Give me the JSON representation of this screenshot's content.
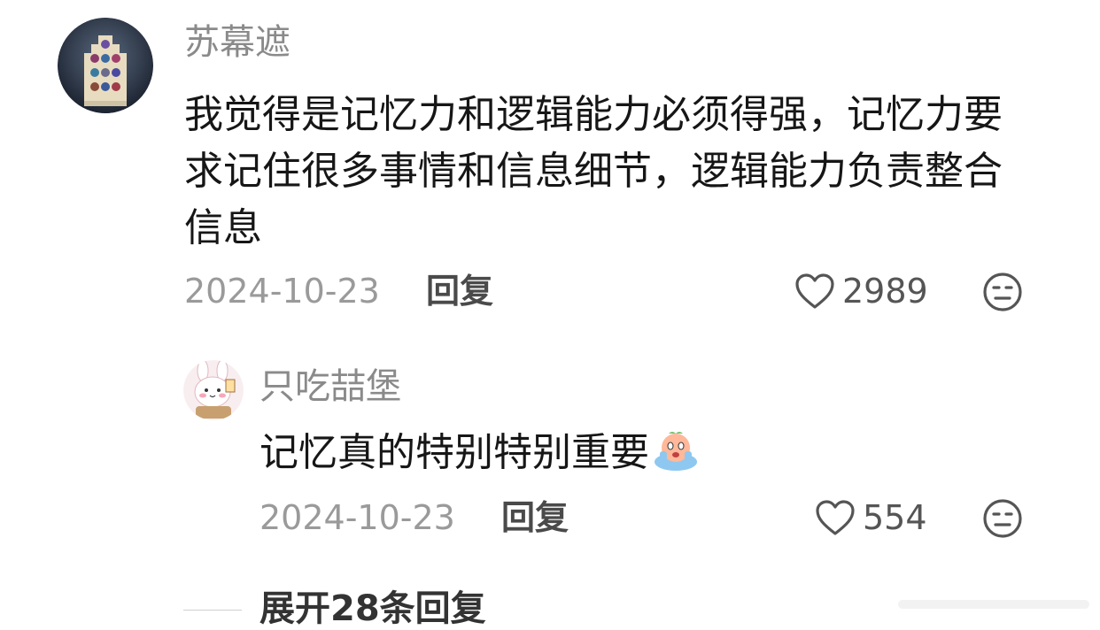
{
  "comments": [
    {
      "username": "苏幕遮",
      "text": "我觉得是记忆力和逻辑能力必须得强，记忆力要求记住很多事情和信息细节，逻辑能力负责整合信息",
      "date": "2024-10-23",
      "reply_label": "回复",
      "likes": "2989",
      "avatar_icon": "stained-glass-building-avatar"
    },
    {
      "username": "只吃喆堡",
      "text": "记忆真的特别特别重要",
      "emoji": "crying-face-emoji",
      "date": "2024-10-23",
      "reply_label": "回复",
      "likes": "554",
      "avatar_icon": "cartoon-bunny-avatar"
    }
  ],
  "expand_replies_label": "展开28条回复",
  "icons": {
    "like": "heart-outline-icon",
    "dislike": "neutral-face-icon"
  },
  "colors": {
    "background": "#ffffff",
    "username": "#8a8a8a",
    "text": "#161616",
    "meta": "#9a9a9a"
  }
}
